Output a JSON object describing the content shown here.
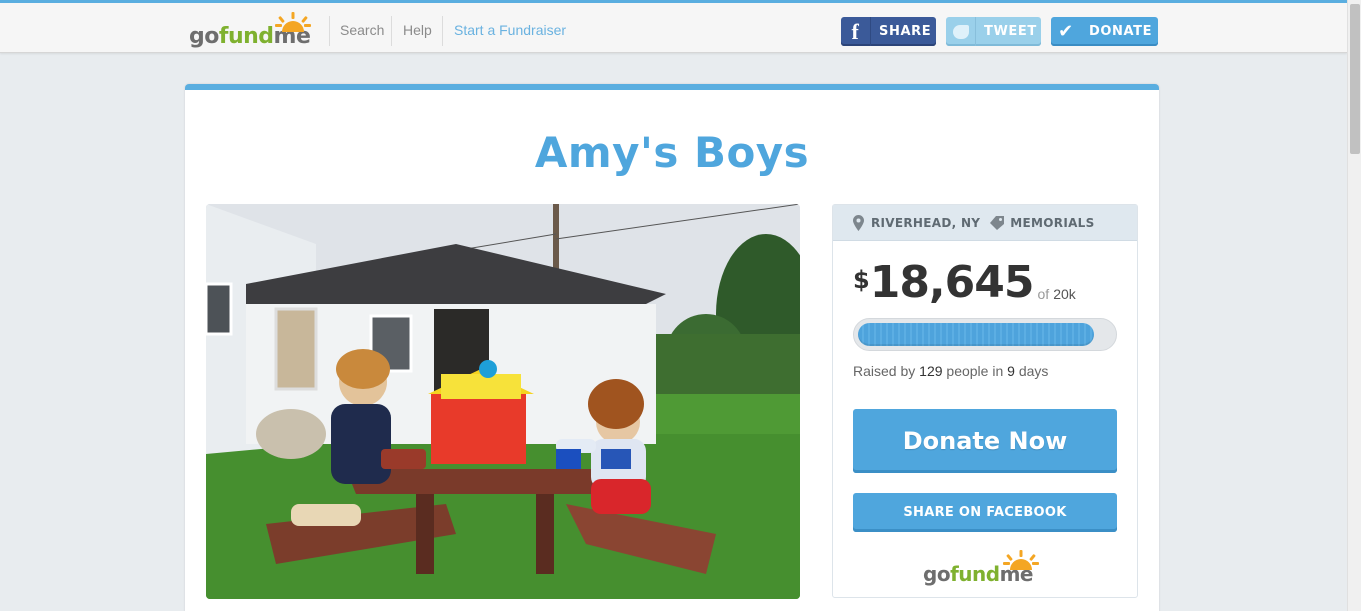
{
  "header": {
    "logo": {
      "go": "go",
      "fund": "fund",
      "me": "me"
    },
    "nav": {
      "search": "Search",
      "help": "Help",
      "start": "Start a Fundraiser"
    },
    "buttons": {
      "share": "SHARE",
      "share_icon": "f",
      "tweet": "TWEET",
      "donate": "DONATE",
      "donate_icon": "✔"
    }
  },
  "campaign": {
    "title": "Amy's Boys",
    "location": "RIVERHEAD, NY",
    "category": "MEMORIALS",
    "currency": "$",
    "raised": "18,645",
    "of_label": "of",
    "goal": "20k",
    "progress_fraction": 0.93,
    "raised_by_prefix": "Raised by",
    "donor_count": "129",
    "people_in": "people in",
    "days": "9",
    "days_suffix": "days",
    "donate_now": "Donate Now",
    "share_facebook": "SHARE ON FACEBOOK"
  },
  "colors": {
    "accent": "#4fa6dd",
    "facebook": "#3b5a99",
    "twitter": "#9ad0ea",
    "logo_green": "#7fb12f",
    "logo_sun": "#f4a623"
  },
  "icons": {
    "location": "map-pin-icon",
    "category": "tag-icon",
    "facebook": "facebook-icon",
    "twitter": "twitter-bird-icon",
    "check": "check-icon"
  }
}
